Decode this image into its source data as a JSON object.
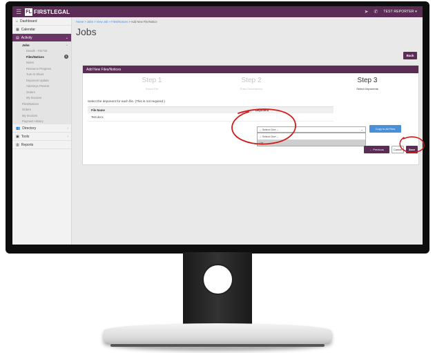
{
  "app": {
    "logo_mark": "FL",
    "logo_text": "FIRSTLEGAL",
    "user_menu": "TEST REPORTER ▾"
  },
  "icons": {
    "menu": "hamburger-icon",
    "location": "location-arrow-icon",
    "phone": "phone-icon"
  },
  "sidebar": {
    "dashboard": "Dashboard",
    "calendar": "Calendar",
    "activity": "Activity",
    "jobs": "Jobs",
    "jobs_sub": [
      "Details - #34733",
      "Files/Notices",
      "Notes",
      "Resource Progress",
      "Turn-in Sheet",
      "Deponent Update",
      "Attorneys Present",
      "Orders",
      "My Invoices"
    ],
    "files_badge": "1",
    "activity_sub": [
      "Files/Notices",
      "Orders",
      "My Invoices",
      "Payment History"
    ],
    "directory": "Directory",
    "tools": "Tools",
    "reports": "Reports"
  },
  "breadcrumb": {
    "links": "Home > Jobs > View Job > Files/Notices",
    "current": " > Add New File/Notice"
  },
  "page": {
    "title": "Jobs",
    "back_label": "Back"
  },
  "panel": {
    "header": "Add New Files/Notices",
    "steps": [
      {
        "title": "Step 1",
        "sub": "Select File"
      },
      {
        "title": "Step 2",
        "sub": "Enter Descriptions"
      },
      {
        "title": "Step 3",
        "sub": "Select Deponents"
      }
    ],
    "instructions": "Select the deponent for each file. (This is not required.)",
    "columns": [
      "File Name",
      "Deponent"
    ],
    "rows": [
      {
        "file": "Test.docx"
      }
    ],
    "select_value": "-- Select One --",
    "dropdown_options": [
      "-- Select One --",
      "j.m"
    ],
    "copy_label": "Copy to All Files",
    "previous_label": "← Previous",
    "cancel_label": "Cancel",
    "save_label": "Save"
  },
  "colors": {
    "brand": "#5b2c55",
    "link": "#4a90d9",
    "annotation": "#d11a1a"
  }
}
